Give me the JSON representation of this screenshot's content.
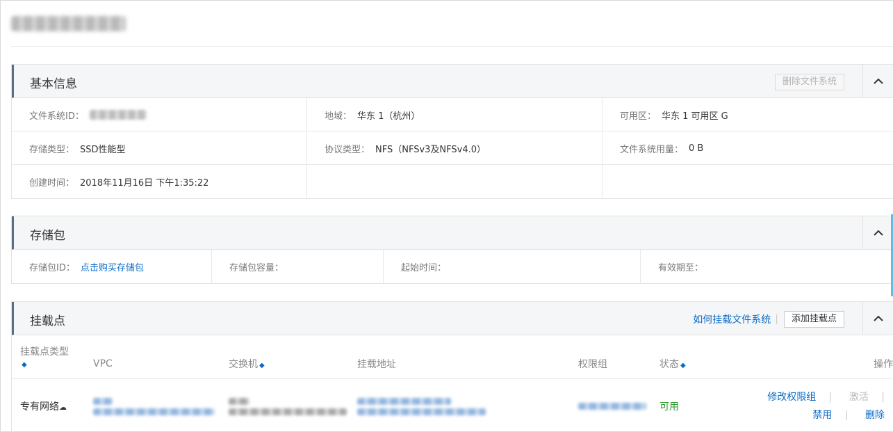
{
  "basic_info": {
    "title": "基本信息",
    "delete_button": "删除文件系统",
    "fs_id_label": "文件系统ID：",
    "region_label": "地域：",
    "region_value": "华东 1（杭州）",
    "zone_label": "可用区：",
    "zone_value": "华东 1 可用区 G",
    "storage_type_label": "存储类型：",
    "storage_type_value": "SSD性能型",
    "protocol_label": "协议类型：",
    "protocol_value": "NFS（NFSv3及NFSv4.0）",
    "usage_label": "文件系统用量：",
    "usage_value": "0 B",
    "created_label": "创建时间：",
    "created_value": "2018年11月16日 下午1:35:22"
  },
  "storage_package": {
    "title": "存储包",
    "pkg_id_label": "存储包ID：",
    "pkg_id_link": "点击购买存储包",
    "capacity_label": "存储包容量：",
    "start_label": "起始时间：",
    "expire_label": "有效期至："
  },
  "mount_points": {
    "title": "挂载点",
    "how_to_link": "如何挂载文件系统",
    "add_button": "添加挂载点",
    "columns": {
      "type": "挂载点类型",
      "vpc": "VPC",
      "vswitch": "交换机",
      "address": "挂载地址",
      "permission_group": "权限组",
      "status": "状态",
      "actions": "操作"
    },
    "rows": [
      {
        "type": "专有网络",
        "status": "可用",
        "action_modify": "修改权限组",
        "action_activate": "激活",
        "action_disable": "禁用",
        "action_delete": "删除"
      }
    ]
  },
  "icons": {
    "collapse": "chevron-up-icon",
    "sort": "sort-icon",
    "vpc_cloud": "cloud-icon"
  },
  "colors": {
    "link": "#0a6bc5",
    "status_ok": "#2a9a2a",
    "panel_accent": "#5a6f87"
  }
}
